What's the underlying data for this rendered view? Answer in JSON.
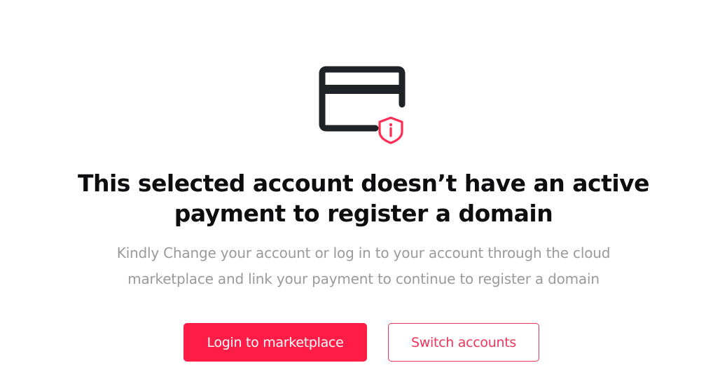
{
  "illustration": {
    "card_icon": "credit-card-icon",
    "badge_icon": "shield-info-icon",
    "card_color": "#1f2327",
    "badge_color": "#ff2e55"
  },
  "title": {
    "line1": "This selected account doesn’t have an active",
    "line2": "payment to register a domain"
  },
  "subtitle": {
    "line1": "Kindly Change your account or log in to your account through the cloud",
    "line2": "marketplace and link your payment to continue to register a domain"
  },
  "buttons": {
    "login_label": "Login to marketplace",
    "switch_label": "Switch accounts"
  },
  "colors": {
    "accent": "#ff1c47",
    "text_primary": "#0e0e10",
    "text_muted": "#9a9a9a"
  }
}
